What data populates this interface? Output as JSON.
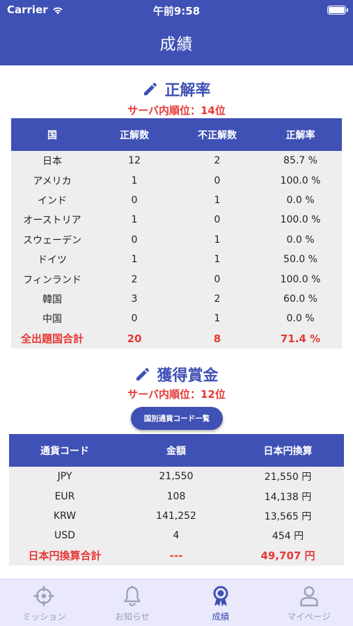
{
  "status_bar": {
    "carrier": "Carrier",
    "time": "午前9:58"
  },
  "nav": {
    "title": "成績"
  },
  "accuracy": {
    "title": "正解率",
    "rank": "サーバ内順位：14位",
    "columns": [
      "国",
      "正解数",
      "不正解数",
      "正解率"
    ],
    "rows": [
      [
        "日本",
        "12",
        "2",
        "85.7 %"
      ],
      [
        "アメリカ",
        "1",
        "0",
        "100.0 %"
      ],
      [
        "インド",
        "0",
        "1",
        "0.0 %"
      ],
      [
        "オーストリア",
        "1",
        "0",
        "100.0 %"
      ],
      [
        "スウェーデン",
        "0",
        "1",
        "0.0 %"
      ],
      [
        "ドイツ",
        "1",
        "1",
        "50.0 %"
      ],
      [
        "フィンランド",
        "2",
        "0",
        "100.0 %"
      ],
      [
        "韓国",
        "3",
        "2",
        "60.0 %"
      ],
      [
        "中国",
        "0",
        "1",
        "0.0 %"
      ]
    ],
    "total": [
      "全出題国合計",
      "20",
      "8",
      "71.4 %"
    ]
  },
  "prize": {
    "title": "獲得賞金",
    "rank": "サーバ内順位：12位",
    "button_label": "国別通貨コード一覧",
    "columns": [
      "通貨コード",
      "金額",
      "日本円換算"
    ],
    "rows": [
      [
        "JPY",
        "21,550",
        "21,550 円"
      ],
      [
        "EUR",
        "108",
        "14,138 円"
      ],
      [
        "KRW",
        "141,252",
        "13,565 円"
      ],
      [
        "USD",
        "4",
        "454 円"
      ]
    ],
    "total": [
      "日本円換算合計",
      "---",
      "49,707 円"
    ]
  },
  "tabbar": {
    "items": [
      {
        "label": "ミッション",
        "icon": "crosshair-icon",
        "active": false
      },
      {
        "label": "お知らせ",
        "icon": "bell-icon",
        "active": false
      },
      {
        "label": "成績",
        "icon": "medal-icon",
        "active": true
      },
      {
        "label": "マイページ",
        "icon": "person-icon",
        "active": false
      }
    ]
  },
  "colors": {
    "primary": "#3f51b5",
    "accent_red": "#e53935",
    "row_bg": "#eeeeee",
    "tabbar_bg": "#e9e9fb"
  }
}
